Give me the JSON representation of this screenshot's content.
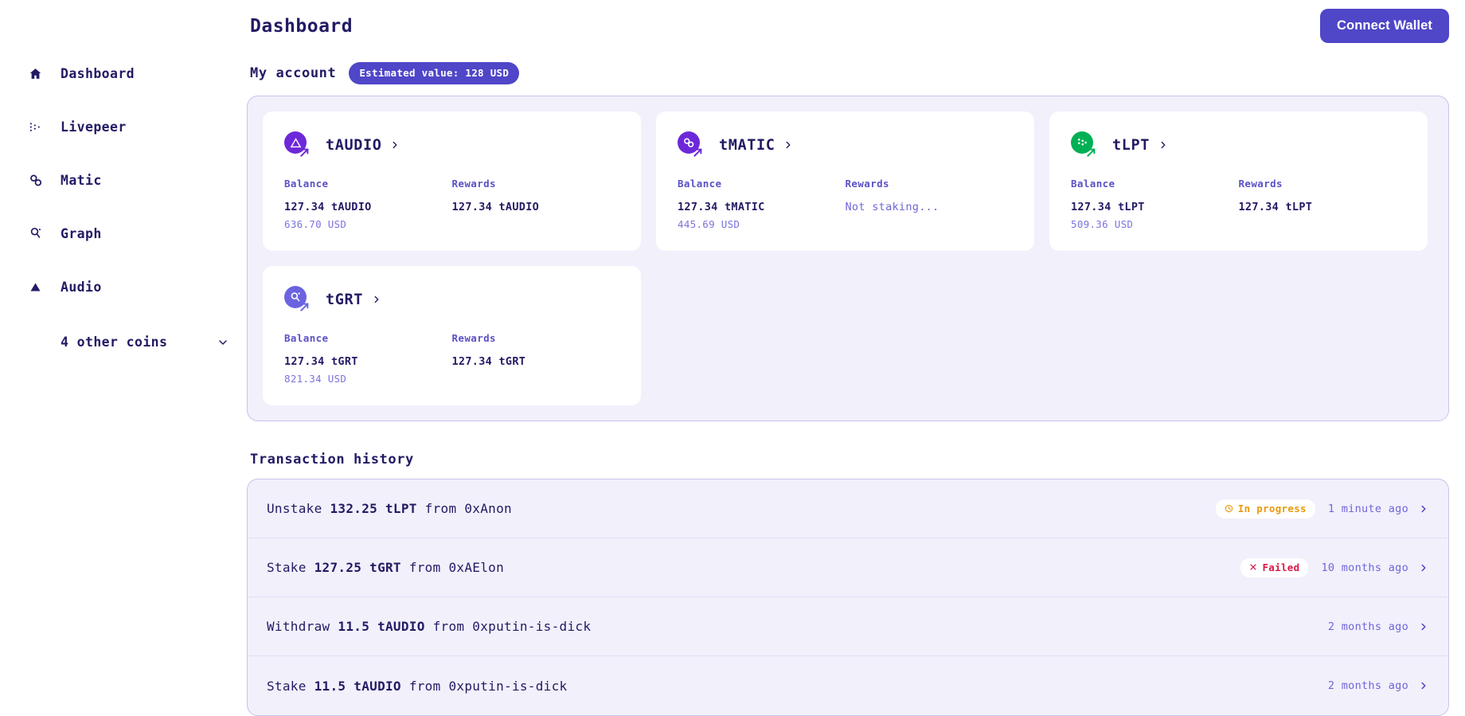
{
  "header": {
    "title": "Dashboard",
    "connect_wallet_label": "Connect Wallet"
  },
  "sidebar": {
    "items": [
      {
        "label": "Dashboard",
        "icon": "home-icon"
      },
      {
        "label": "Livepeer",
        "icon": "livepeer-icon"
      },
      {
        "label": "Matic",
        "icon": "matic-icon"
      },
      {
        "label": "Graph",
        "icon": "graph-icon"
      },
      {
        "label": "Audio",
        "icon": "audio-icon"
      }
    ],
    "other_coins_label": "4 other coins",
    "other_coins_icon": "chevron-down-icon"
  },
  "account": {
    "section_title": "My account",
    "estimated_value_badge": "Estimated value: 128 USD",
    "balance_label": "Balance",
    "rewards_label": "Rewards",
    "cards": [
      {
        "symbol": "tAUDIO",
        "icon": "audio-token-icon",
        "color": "#6d28d9",
        "balance": "127.34 tAUDIO",
        "balance_usd": "636.70 USD",
        "rewards": "127.34 tAUDIO",
        "rewards_muted": false
      },
      {
        "symbol": "tMATIC",
        "icon": "matic-token-icon",
        "color": "#6d28d9",
        "balance": "127.34 tMATIC",
        "balance_usd": "445.69 USD",
        "rewards": "Not staking...",
        "rewards_muted": true
      },
      {
        "symbol": "tLPT",
        "icon": "livepeer-token-icon",
        "color": "#00b055",
        "balance": "127.34 tLPT",
        "balance_usd": "509.36 USD",
        "rewards": "127.34 tLPT",
        "rewards_muted": false
      },
      {
        "symbol": "tGRT",
        "icon": "graph-token-icon",
        "color": "#6b63e0",
        "balance": "127.34 tGRT",
        "balance_usd": "821.34 USD",
        "rewards": "127.34 tGRT",
        "rewards_muted": false
      }
    ]
  },
  "transactions": {
    "title": "Transaction history",
    "rows": [
      {
        "action": "Unstake",
        "amount": "132.25 tLPT",
        "from_label": "from",
        "address": "0xAnon",
        "status": "In progress",
        "status_kind": "inprogress",
        "status_icon": "clock-icon",
        "time": "1 minute ago"
      },
      {
        "action": "Stake",
        "amount": "127.25 tGRT",
        "from_label": "from",
        "address": "0xAElon",
        "status": "Failed",
        "status_kind": "failed",
        "status_icon": "cross-icon",
        "time": "10 months ago"
      },
      {
        "action": "Withdraw",
        "amount": "11.5 tAUDIO",
        "from_label": "from",
        "address": "0xputin-is-dick",
        "status": "",
        "status_kind": "none",
        "status_icon": "",
        "time": "2 months ago"
      },
      {
        "action": "Stake",
        "amount": "11.5 tAUDIO",
        "from_label": "from",
        "address": "0xputin-is-dick",
        "status": "",
        "status_kind": "none",
        "status_icon": "",
        "time": "2 months ago"
      }
    ]
  },
  "colors": {
    "accent": "#4f46c8",
    "text": "#221b64",
    "muted": "#6f66d8",
    "panel_bg": "#f1f0fb",
    "panel_border": "#c8c4ee",
    "warning": "#e99a0b",
    "danger": "#d91846",
    "success": "#00b055"
  }
}
